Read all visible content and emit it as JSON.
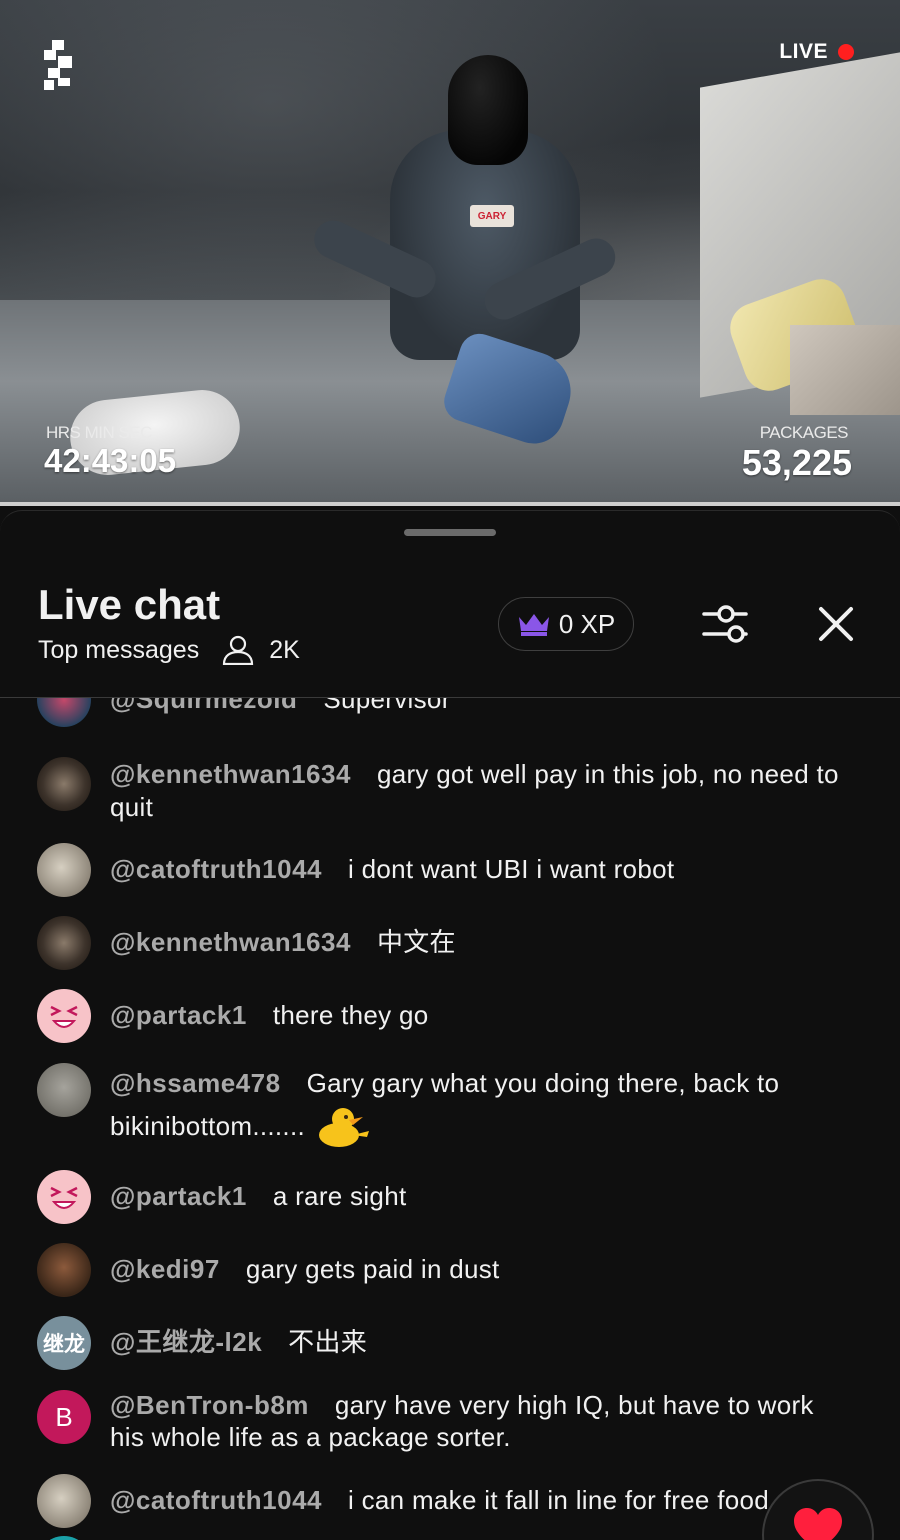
{
  "video": {
    "live_label": "LIVE",
    "timer_label": "HRS MIN SEC",
    "timer_value": "42:43:05",
    "packages_label": "PACKAGES",
    "packages_value": "53,225",
    "badge_text": "GARY"
  },
  "chat": {
    "title": "Live chat",
    "subtitle": "Top messages",
    "viewer_count": "2K",
    "xp_label": "0 XP",
    "icons": {
      "viewer": "person-icon",
      "xp": "crown-icon",
      "filter": "sliders-icon",
      "close": "close-icon",
      "heart": "heart-icon"
    },
    "colors": {
      "live_dot": "#ff1f1f",
      "crown": "#8a56e8",
      "heart": "#ff1f3d"
    },
    "messages": [
      {
        "author": "@Squirmezoid",
        "text": "Supervisor",
        "avatar": ""
      },
      {
        "author": "@kennethwan1634",
        "text": "gary got well pay in this job, no need to quit",
        "avatar": ""
      },
      {
        "author": "@catoftruth1044",
        "text": "i dont want UBI i want robot",
        "avatar": ""
      },
      {
        "author": "@kennethwan1634",
        "text": "中文在",
        "avatar": ""
      },
      {
        "author": "@partack1",
        "text": "there they go",
        "avatar": ""
      },
      {
        "author": "@hssame478",
        "text": "Gary gary what you doing there, back to bikinibottom.......",
        "avatar": ""
      },
      {
        "author": "@partack1",
        "text": "a rare sight",
        "avatar": ""
      },
      {
        "author": "@kedi97",
        "text": "gary gets paid in dust",
        "avatar": ""
      },
      {
        "author": "@王继龙-l2k",
        "text": "不出来",
        "avatar": "继龙"
      },
      {
        "author": "@BenTron-b8m",
        "text": "gary have very high IQ, but have to work his whole life as a package sorter.",
        "avatar": "B"
      },
      {
        "author": "@catoftruth1044",
        "text": "i can make it fall in line for free food",
        "avatar": ""
      }
    ]
  }
}
